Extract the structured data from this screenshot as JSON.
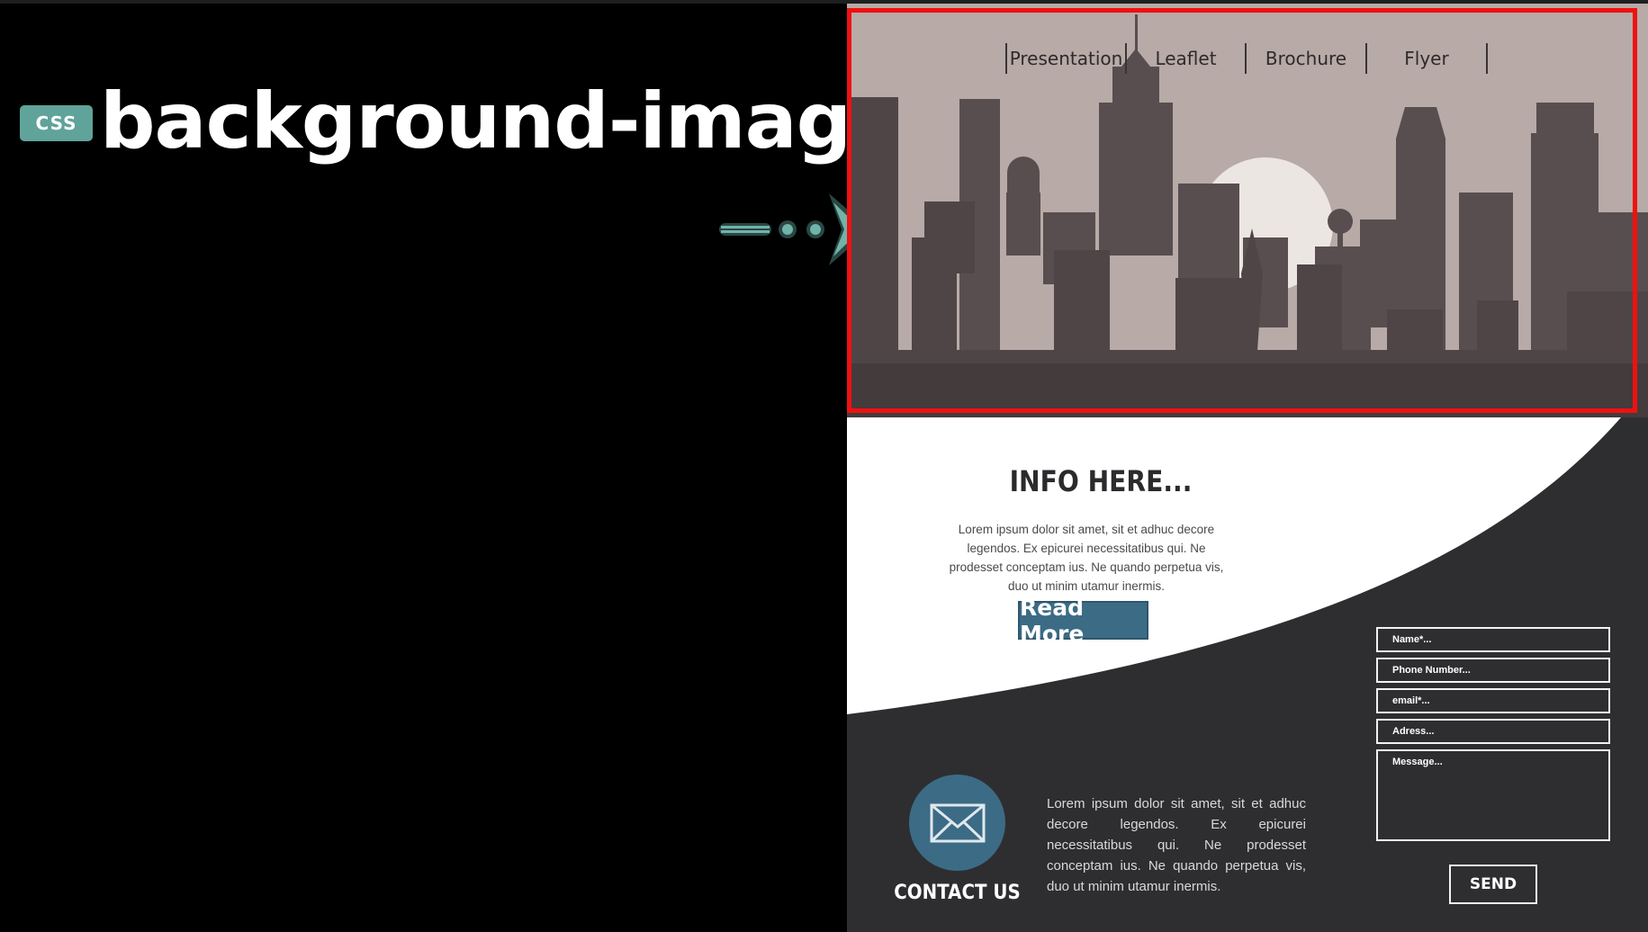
{
  "slide": {
    "badge": "CSS",
    "heading": "background-image"
  },
  "mockup": {
    "nav": [
      "Presentation",
      "Leaflet",
      "Brochure",
      "Flyer"
    ],
    "info_title": "INFO HERE...",
    "info_text": "Lorem ipsum dolor sit amet, sit et adhuc decore legendos. Ex epicurei necessitatibus qui. Ne prodesset conceptam ius. Ne quando  perpetua vis, duo ut minim utamur inermis.",
    "read_more": "Read More",
    "contact_label": "CONTACT US",
    "contact_text": "Lorem ipsum dolor sit amet, sit et adhuc decore legendos. Ex epicurei necessitatibus qui. Ne prodesset conceptam ius. Ne quando  perpetua vis, duo ut minim utamur inermis.",
    "form": {
      "name_placeholder": "Name*...",
      "phone_placeholder": "Phone Number...",
      "email_placeholder": "email*...",
      "address_placeholder": "Adress...",
      "message_placeholder": "Message...",
      "send": "SEND"
    }
  },
  "colors": {
    "accent": "#5fa39a",
    "highlight": "#ee1111",
    "button_blue": "#3c6b85",
    "sky": "#b7aaa7",
    "buildings": "#4f4546",
    "dark_panel": "#2e2e31"
  },
  "icons": [
    "arrow-icon",
    "envelope-icon"
  ]
}
